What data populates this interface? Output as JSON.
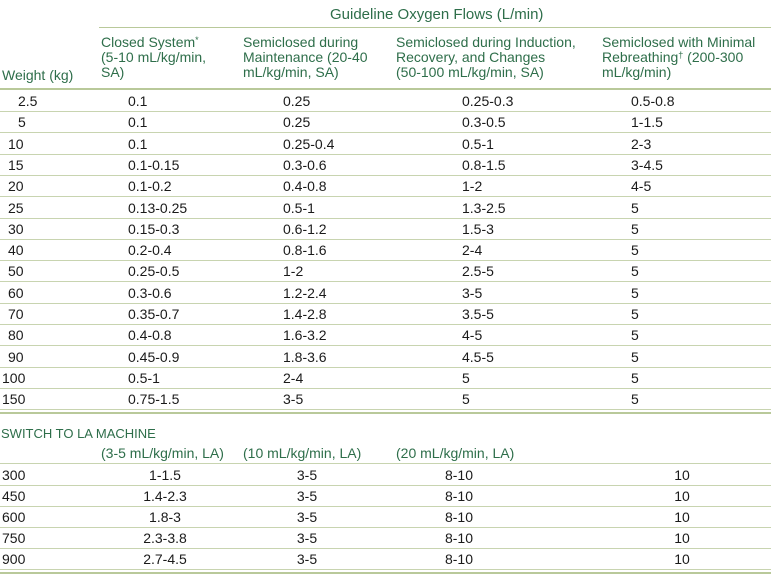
{
  "title": "Guideline Oxygen Flows (L/min)",
  "headers": {
    "weight": "Weight (kg)",
    "col1_a": "Closed System",
    "col1_sup": "*",
    "col1_b": "(5-10 mL/kg/min,",
    "col1_c": "SA)",
    "col2_a": "Semiclosed during",
    "col2_b": "Maintenance (20-40",
    "col2_c": "mL/kg/min, SA)",
    "col3_a": "Semiclosed during Induction,",
    "col3_b": "Recovery, and Changes",
    "col3_c": "(50-100 mL/kg/min, SA)",
    "col4_a": "Semiclosed with Minimal",
    "col4_b": "Rebreathing",
    "col4_sup": "†",
    "col4_b2": " (200-300",
    "col4_c": "mL/kg/min)"
  },
  "sa_rows": [
    [
      "2.5",
      "0.1",
      "0.25",
      "0.25-0.3",
      "0.5-0.8"
    ],
    [
      "5",
      "0.1",
      "0.25",
      "0.3-0.5",
      "1-1.5"
    ],
    [
      "10",
      "0.1",
      "0.25-0.4",
      "0.5-1",
      "2-3"
    ],
    [
      "15",
      "0.1-0.15",
      "0.3-0.6",
      "0.8-1.5",
      "3-4.5"
    ],
    [
      "20",
      "0.1-0.2",
      "0.4-0.8",
      "1-2",
      "4-5"
    ],
    [
      "25",
      "0.13-0.25",
      "0.5-1",
      "1.3-2.5",
      "5"
    ],
    [
      "30",
      "0.15-0.3",
      "0.6-1.2",
      "1.5-3",
      "5"
    ],
    [
      "40",
      "0.2-0.4",
      "0.8-1.6",
      "2-4",
      "5"
    ],
    [
      "50",
      "0.25-0.5",
      "1-2",
      "2.5-5",
      "5"
    ],
    [
      "60",
      "0.3-0.6",
      "1.2-2.4",
      "3-5",
      "5"
    ],
    [
      "70",
      "0.35-0.7",
      "1.4-2.8",
      "3.5-5",
      "5"
    ],
    [
      "80",
      "0.4-0.8",
      "1.6-3.2",
      "4-5",
      "5"
    ],
    [
      "90",
      "0.45-0.9",
      "1.8-3.6",
      "4.5-5",
      "5"
    ],
    [
      "100",
      "0.5-1",
      "2-4",
      "5",
      "5"
    ],
    [
      "150",
      "0.75-1.5",
      "3-5",
      "5",
      "5"
    ]
  ],
  "la_section": {
    "label": "SWITCH TO LA MACHINE",
    "sub1": "(3-5 mL/kg/min, LA)",
    "sub2": "(10 mL/kg/min, LA)",
    "sub3": "(20 mL/kg/min, LA)"
  },
  "la_rows": [
    [
      "300",
      "1-1.5",
      "3-5",
      "8-10",
      "10"
    ],
    [
      "450",
      "1.4-2.3",
      "3-5",
      "8-10",
      "10"
    ],
    [
      "600",
      "1.8-3",
      "3-5",
      "8-10",
      "10"
    ],
    [
      "750",
      "2.3-3.8",
      "3-5",
      "8-10",
      "10"
    ],
    [
      "900",
      "2.7-4.5",
      "3-5",
      "8-10",
      "10"
    ]
  ]
}
